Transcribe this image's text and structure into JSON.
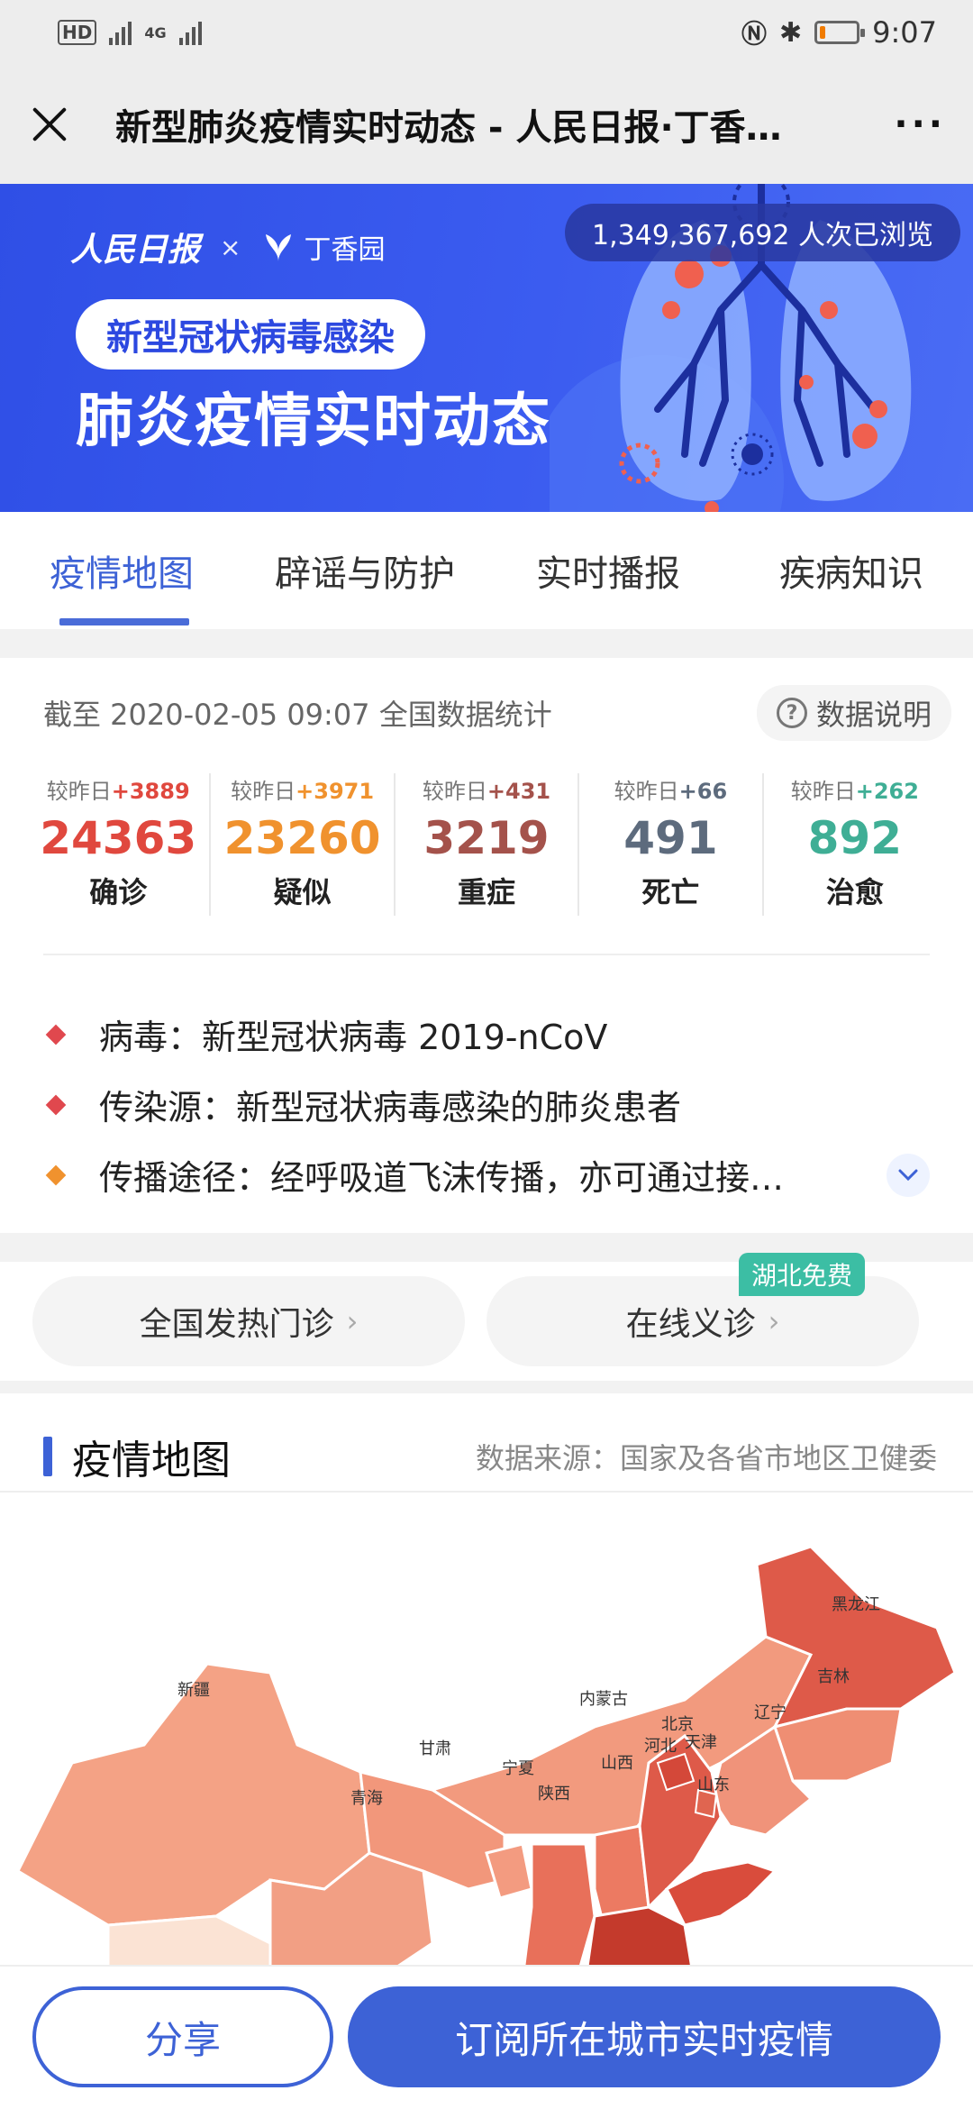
{
  "status_bar": {
    "hd_badge": "HD",
    "net_1": "4G",
    "time": "9:07",
    "battery_level": 0.15
  },
  "nav": {
    "title": "新型肺炎疫情实时动态 - 人民日报·丁香…",
    "more": "···"
  },
  "banner": {
    "brand_rmrb": "人民日报",
    "brand_x": "×",
    "brand_dxy": "丁香园",
    "views": "1,349,367,692 人次已浏览",
    "subtitle": "新型冠状病毒感染",
    "headline": "肺炎疫情实时动态"
  },
  "tabs": [
    {
      "label": "疫情地图",
      "active": true
    },
    {
      "label": "辟谣与防护",
      "active": false
    },
    {
      "label": "实时播报",
      "active": false
    },
    {
      "label": "疾病知识",
      "active": false
    }
  ],
  "stats": {
    "as_of": "截至 2020-02-05 09:07 全国数据统计",
    "data_note": "数据说明",
    "items": [
      {
        "delta_prefix": "较昨日",
        "delta": "+3889",
        "value": "24363",
        "label": "确诊",
        "color": "#e0483e"
      },
      {
        "delta_prefix": "较昨日",
        "delta": "+3971",
        "value": "23260",
        "label": "疑似",
        "color": "#f0922e"
      },
      {
        "delta_prefix": "较昨日",
        "delta": "+431",
        "value": "3219",
        "label": "重症",
        "color": "#a4524b"
      },
      {
        "delta_prefix": "较昨日",
        "delta": "+66",
        "value": "491",
        "label": "死亡",
        "color": "#5d6b7d"
      },
      {
        "delta_prefix": "较昨日",
        "delta": "+262",
        "value": "892",
        "label": "治愈",
        "color": "#3fae95"
      }
    ],
    "info": [
      {
        "text": "病毒：新型冠状病毒 2019-nCoV",
        "color": "#e0484e"
      },
      {
        "text": "传染源：新型冠状病毒感染的肺炎患者",
        "color": "#e0484e"
      },
      {
        "text": "传播途径：经呼吸道飞沫传播，亦可通过接…",
        "color": "#f0922e"
      }
    ]
  },
  "pills": {
    "fever_clinic": "全国发热门诊",
    "online_consult": "在线义诊",
    "free_badge": "湖北免费"
  },
  "map": {
    "title": "疫情地图",
    "source": "数据来源：国家及各省市地区卫健委",
    "provinces": {
      "xinjiang": "新疆",
      "heilongjiang": "黑龙江",
      "jilin": "吉林",
      "neimenggu": "内蒙古",
      "liaoning": "辽宁",
      "beijing": "北京",
      "tianjin": "天津",
      "hebei": "河北",
      "gansu": "甘肃",
      "ningxia": "宁夏",
      "shanxi": "山西",
      "shandong": "山东",
      "qinghai": "青海",
      "shaanxi": "陕西"
    }
  },
  "bottom": {
    "share": "分享",
    "subscribe": "订阅所在城市实时疫情"
  }
}
